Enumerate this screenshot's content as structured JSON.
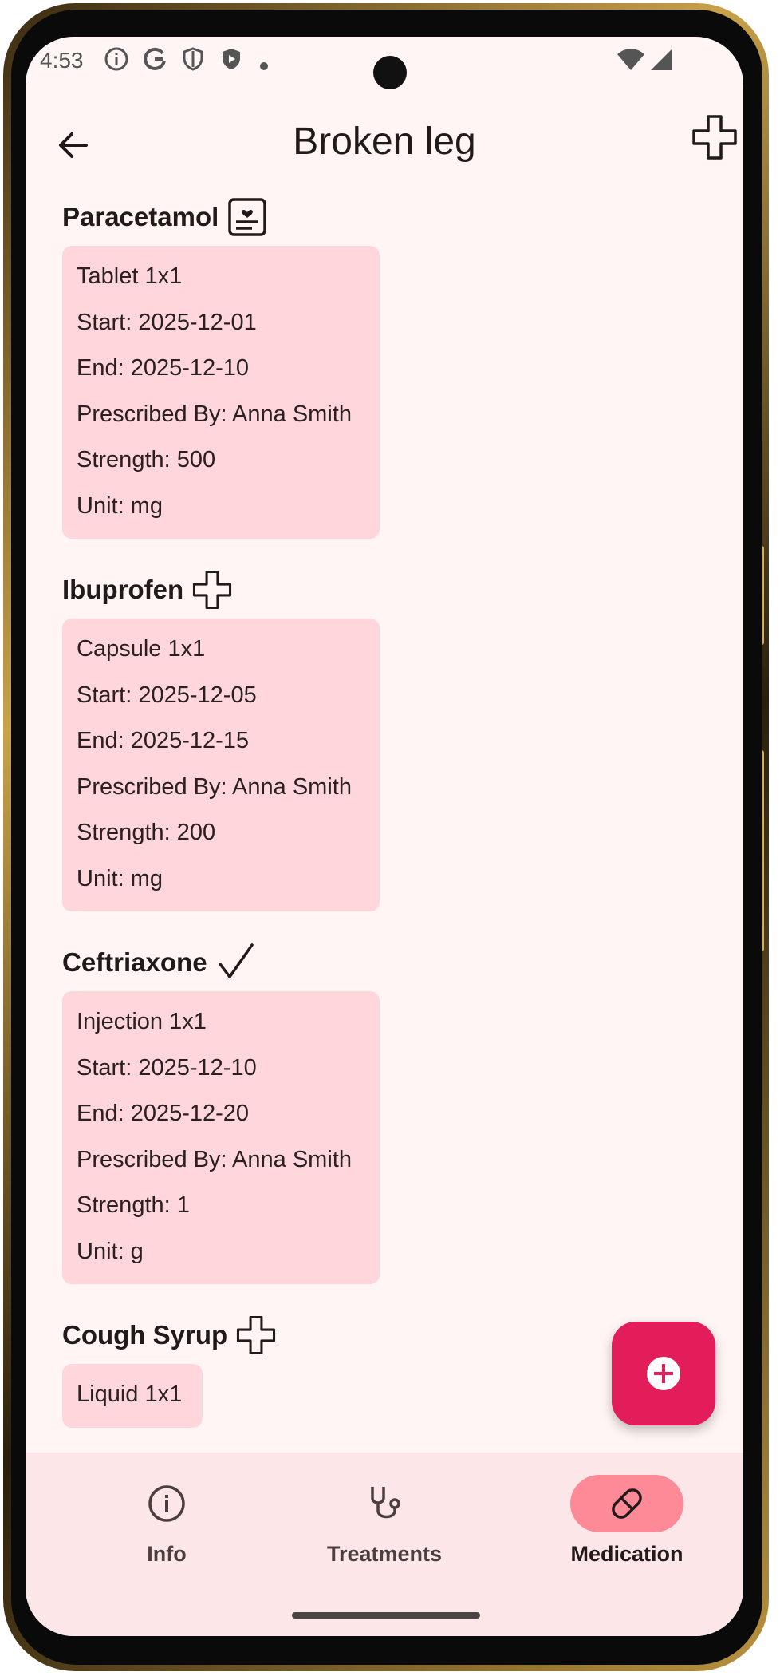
{
  "status_bar": {
    "time": "4:53",
    "icons": [
      "info-icon",
      "google-icon",
      "shield-icon",
      "play-protect-icon",
      "dot-icon",
      "wifi-icon",
      "signal-icon"
    ]
  },
  "app_bar": {
    "title": "Broken leg",
    "back_icon": "arrow-back-icon",
    "action_icon": "medical-cross-icon"
  },
  "medications": [
    {
      "name": "Paracetamol",
      "icon": "medical-record-icon",
      "lines": [
        "Tablet 1x1",
        "Start: 2025-12-01",
        "End: 2025-12-10",
        "Prescribed By: Anna Smith",
        "Strength: 500",
        "Unit: mg"
      ]
    },
    {
      "name": "Ibuprofen",
      "icon": "medical-cross-icon",
      "lines": [
        "Capsule 1x1",
        "Start: 2025-12-05",
        "End: 2025-12-15",
        "Prescribed By: Anna Smith",
        "Strength: 200",
        "Unit: mg"
      ]
    },
    {
      "name": "Ceftriaxone",
      "icon": "checkmark-icon",
      "lines": [
        "Injection 1x1",
        "Start: 2025-12-10",
        "End: 2025-12-20",
        "Prescribed By: Anna Smith",
        "Strength: 1",
        "Unit: g"
      ]
    },
    {
      "name": "Cough Syrup",
      "icon": "medical-cross-icon",
      "lines": [
        "Liquid 1x1"
      ]
    }
  ],
  "fab": {
    "icon": "add-circle-icon"
  },
  "bottom_nav": [
    {
      "label": "Info",
      "icon": "info-icon",
      "active": false
    },
    {
      "label": "Treatments",
      "icon": "stethoscope-icon",
      "active": false
    },
    {
      "label": "Medication",
      "icon": "pill-icon",
      "active": true
    }
  ],
  "colors": {
    "background": "#fff5f4",
    "card": "#ffd6dc",
    "fab": "#e31c5a",
    "nav_bg": "#fde6e7",
    "nav_active": "#ff8a97"
  }
}
